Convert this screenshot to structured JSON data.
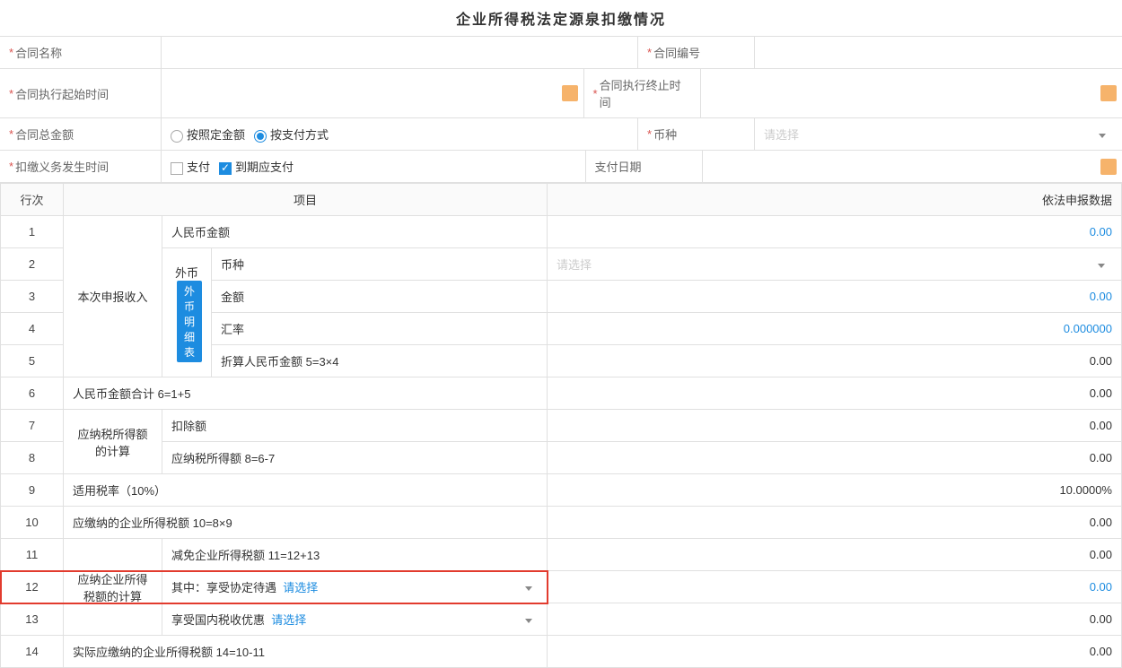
{
  "title": "企业所得税法定源泉扣缴情况",
  "form": {
    "contractName": "合同名称",
    "contractNo": "合同编号",
    "execStart": "合同执行起始时间",
    "execEnd": "合同执行终止时间",
    "totalAmt": "合同总金额",
    "radioByAmt": "按照定金额",
    "radioByPay": "按支付方式",
    "currency": "币种",
    "currencyPh": "请选择",
    "withholdTime": "扣缴义务发生时间",
    "cbPay": "支付",
    "cbDue": "到期应支付",
    "payDate": "支付日期"
  },
  "headers": {
    "seq": "行次",
    "item": "项目",
    "val": "依法申报数据"
  },
  "labels": {
    "income": "本次申报收入",
    "foreign": "外币",
    "foreignBtn": "外币明细表",
    "taxCalc": "应纳税所得额的计算",
    "entTax": "应纳企业所得税额的计算",
    "selectPh": "请选择",
    "currPh": "请选择"
  },
  "rows": [
    {
      "n": "1",
      "item": "人民币金额",
      "val": "0.00",
      "blue": true
    },
    {
      "n": "2",
      "item": "币种",
      "val": "",
      "ph": "请选择",
      "dropdown": true
    },
    {
      "n": "3",
      "item": "金额",
      "val": "0.00",
      "blue": true
    },
    {
      "n": "4",
      "item": "汇率",
      "val": "0.000000",
      "blue": true
    },
    {
      "n": "5",
      "item": "折算人民币金额 5=3×4",
      "val": "0.00"
    },
    {
      "n": "6",
      "item": "人民币金额合计 6=1+5",
      "val": "0.00"
    },
    {
      "n": "7",
      "item": "扣除额",
      "val": "0.00"
    },
    {
      "n": "8",
      "item": "应纳税所得额 8=6-7",
      "val": "0.00"
    },
    {
      "n": "9",
      "item": "适用税率（10%）",
      "val": "10.0000%"
    },
    {
      "n": "10",
      "item": "应缴纳的企业所得税额 10=8×9",
      "val": "0.00"
    },
    {
      "n": "11",
      "item": "减免企业所得税额 11=12+13",
      "val": "0.00"
    },
    {
      "n": "12",
      "item": "其中：享受协定待遇",
      "val": "0.00",
      "blue": true,
      "select": true
    },
    {
      "n": "13",
      "item": "享受国内税收优惠",
      "val": "0.00",
      "select": true
    },
    {
      "n": "14",
      "item": "实际应缴纳的企业所得税额 14=10-11",
      "val": "0.00"
    }
  ]
}
